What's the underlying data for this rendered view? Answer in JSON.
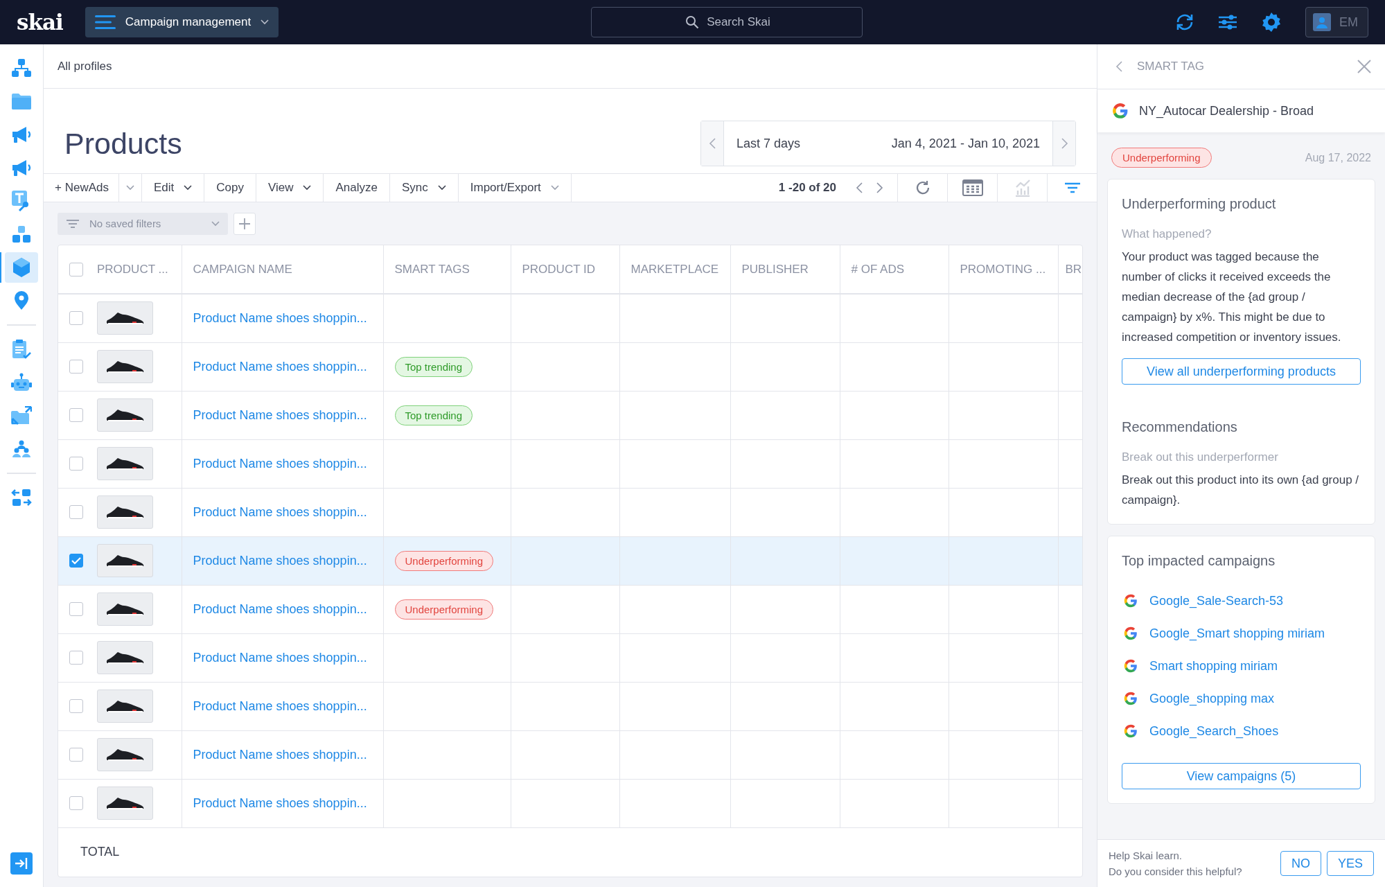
{
  "top_bar": {
    "logo": "skai",
    "menu_label": "Campaign management",
    "search": {
      "placeholder": "Search Skai"
    },
    "icons": [
      {
        "kind": "sync"
      },
      {
        "kind": "sliders"
      },
      {
        "kind": "gear"
      }
    ],
    "user_initials": "EM"
  },
  "sidebar": {
    "groups": [
      [
        {
          "kind": "hierarchy",
          "selected": false
        },
        {
          "kind": "folder",
          "selected": false
        },
        {
          "kind": "megaphone",
          "selected": false
        },
        {
          "kind": "megaphone",
          "selected": false
        },
        {
          "kind": "text-key",
          "selected": false
        },
        {
          "kind": "boxes",
          "selected": false
        },
        {
          "kind": "cube",
          "selected": true
        },
        {
          "kind": "pin",
          "selected": false
        }
      ],
      [
        {
          "kind": "clipboard",
          "selected": false
        },
        {
          "kind": "robot",
          "selected": false
        },
        {
          "kind": "folder-arrows",
          "selected": false
        },
        {
          "kind": "people",
          "selected": false
        }
      ],
      [
        {
          "kind": "swap-arrows",
          "selected": false
        }
      ]
    ]
  },
  "breadcrumb": "All profiles",
  "page_title": "Products",
  "date_picker": {
    "preset": "Last 7 days",
    "range": "Jan 4, 2021 - Jan 10, 2021"
  },
  "toolbar": {
    "buttons": [
      {
        "label": "+ NewAds",
        "kind": "split"
      },
      {
        "label": "Edit",
        "kind": "dropdown"
      },
      {
        "label": "Copy",
        "kind": "plain"
      },
      {
        "label": "View",
        "kind": "dropdown"
      },
      {
        "label": "Analyze",
        "kind": "plain"
      },
      {
        "label": "Sync",
        "kind": "dropdown"
      },
      {
        "label": "Import/Export",
        "kind": "dropdown"
      }
    ],
    "pagination": "1 -20 of 20",
    "icon_buttons": [
      {
        "kind": "refresh",
        "disabled": false,
        "active": false
      },
      {
        "kind": "columns",
        "disabled": false,
        "active": false
      },
      {
        "kind": "chart",
        "disabled": true,
        "active": false
      },
      {
        "kind": "filter",
        "disabled": false,
        "active": true
      }
    ]
  },
  "saved_filters": {
    "placeholder": "No saved filters"
  },
  "table": {
    "header_checked": false,
    "columns": [
      "PRODUCT ...",
      "CAMPAIGN NAME",
      "SMART TAGS",
      "PRODUCT ID",
      "MARKETPLACE",
      "PUBLISHER",
      "# OF ADS",
      "PROMOTING ...",
      "BR"
    ],
    "rows": [
      {
        "checked": false,
        "campaign": "Product Name shoes shoppin..."
      },
      {
        "checked": false,
        "campaign": "Product Name shoes shoppin...",
        "tag": {
          "kind": "top_trending",
          "label": "Top trending"
        }
      },
      {
        "checked": false,
        "campaign": "Product Name shoes shoppin...",
        "tag": {
          "kind": "top_trending",
          "label": "Top trending"
        }
      },
      {
        "checked": false,
        "campaign": "Product Name shoes shoppin..."
      },
      {
        "checked": false,
        "campaign": "Product Name shoes shoppin..."
      },
      {
        "checked": true,
        "campaign": "Product Name shoes shoppin...",
        "tag": {
          "kind": "underperforming",
          "label": "Underperforming"
        }
      },
      {
        "checked": false,
        "campaign": "Product Name shoes shoppin...",
        "tag": {
          "kind": "underperforming",
          "label": "Underperforming"
        }
      },
      {
        "checked": false,
        "campaign": "Product Name shoes shoppin..."
      },
      {
        "checked": false,
        "campaign": "Product Name shoes shoppin..."
      },
      {
        "checked": false,
        "campaign": "Product Name shoes shoppin..."
      },
      {
        "checked": false,
        "campaign": "Product Name shoes shoppin..."
      }
    ],
    "total_label": "TOTAL"
  },
  "panel": {
    "title": "SMART TAG",
    "entity": "NY_Autocar Dealership - Broad",
    "tag": {
      "kind": "underperforming",
      "label": "Underperforming"
    },
    "date": "Aug 17, 2022",
    "details": {
      "title": "Underperforming product",
      "what_label": "What happened?",
      "what_text": "Your product was tagged because the number of clicks it received exceeds the median decrease of the {ad group / campaign} by x%. This might be due to increased competition or inventory issues.",
      "action": "View all underperforming products",
      "rec_title": "Recommendations",
      "rec_label": "Break out this underperformer",
      "rec_text": "Break out this product into its own {ad group / campaign}."
    },
    "impacted": {
      "title": "Top impacted campaigns",
      "campaigns": [
        "Google_Sale-Search-53",
        "Google_Smart shopping miriam",
        "Smart shopping miriam",
        "Google_shopping max",
        "Google_Search_Shoes"
      ],
      "action": "View campaigns (5)"
    },
    "feedback": {
      "line1": "Help Skai learn.",
      "line2": "Do you consider this helpful?",
      "no": "NO",
      "yes": "YES"
    }
  }
}
